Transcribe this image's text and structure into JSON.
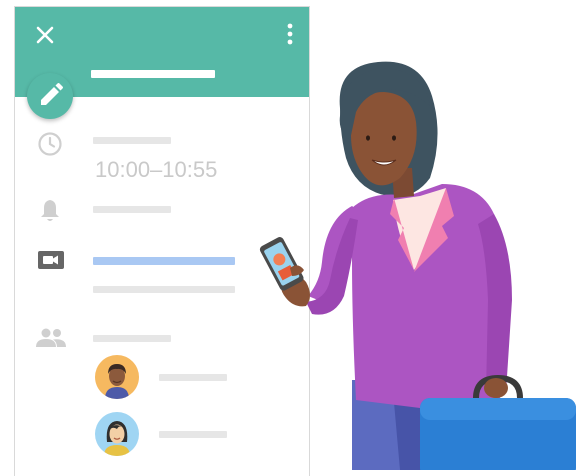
{
  "event": {
    "time_range": "10:00–10:55"
  },
  "colors": {
    "header": "#56b9a7",
    "accent_link": "#a9c8f3",
    "placeholder": "#e6e6e6",
    "icon": "#cfcfcf"
  },
  "icons": {
    "close": "close-icon",
    "more": "more-vert-icon",
    "edit": "pencil-icon",
    "time": "clock-icon",
    "notification": "bell-icon",
    "video": "video-camera-icon",
    "guests": "people-icon"
  }
}
